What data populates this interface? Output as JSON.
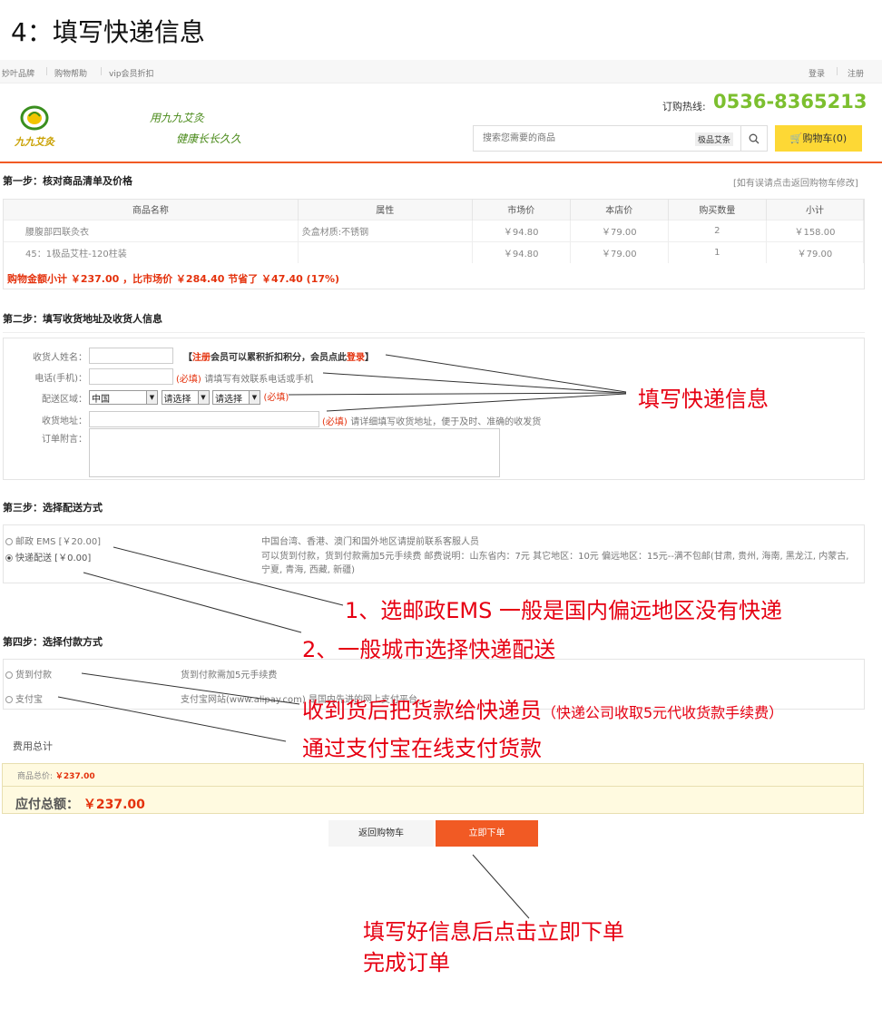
{
  "page_heading": "4：填写快递信息",
  "topbar": {
    "left_links": [
      "妙叶品牌",
      "购物帮助",
      "vip会员折扣"
    ],
    "right_links": [
      "登录",
      "注册"
    ]
  },
  "header": {
    "logo_text": "九九艾灸",
    "slogan_line1": "用九九艾灸",
    "slogan_line2": "健康长长久久",
    "hotline_label": "订购热线:",
    "hotline_number": "0536-8365213",
    "search_placeholder": "搜索您需要的商品",
    "search_tag": "极品艾条",
    "cart_label": "购物车(0)"
  },
  "step1": {
    "title": "第一步：核对商品清单及价格",
    "note": "[如有误请点击返回购物车修改]",
    "columns": [
      "商品名称",
      "属性",
      "市场价",
      "本店价",
      "购买数量",
      "小计"
    ],
    "rows": [
      [
        "腰腹部四联灸衣",
        "灸盒材质:不锈钢",
        "￥94.80",
        "￥79.00",
        "2",
        "￥158.00"
      ],
      [
        "45：1极品艾柱-120柱装",
        "",
        "￥94.80",
        "￥79.00",
        "1",
        "￥79.00"
      ]
    ],
    "summary": "购物金额小计 ￥237.00 ，比市场价 ￥284.40 节省了 ￥47.40 (17%)"
  },
  "step2": {
    "title": "第二步：填写收货地址及收货人信息",
    "name_label": "收货人姓名：",
    "name_hint_pre": "【",
    "name_hint_register": "注册",
    "name_hint_mid": "会员可以累积折扣积分，会员点此",
    "name_hint_login": "登录",
    "name_hint_post": "】",
    "phone_label": "电话(手机)：",
    "required": "(必填)",
    "phone_hint": "请填写有效联系电话或手机",
    "region_label": "配送区域：",
    "country": "中国",
    "select_placeholder": "请选择",
    "address_label": "收货地址：",
    "address_hint": "请详细填写收货地址，便于及时、准确的收发货",
    "remark_label": "订单附言："
  },
  "step3": {
    "title": "第三步：选择配送方式",
    "options": [
      {
        "label": "邮政 EMS [￥20.00]",
        "desc": "中国台湾、香港、澳门和国外地区请提前联系客服人员",
        "selected": false
      },
      {
        "label": "快递配送 [￥0.00]",
        "desc": "可以货到付款，货到付款需加5元手续费 邮费说明：山东省内：7元 其它地区：10元 偏远地区：15元--满不包邮(甘肃, 贵州, 海南, 黑龙江, 内蒙古, 宁夏, 青海, 西藏, 新疆)",
        "selected": true
      }
    ]
  },
  "step4": {
    "title": "第四步：选择付款方式",
    "options": [
      {
        "label": "货到付款",
        "desc": "货到付款需加5元手续费",
        "selected": false
      },
      {
        "label": "支付宝",
        "desc": "支付宝网站(www.alipay.com) 是国内先进的网上支付平台。",
        "selected": false
      }
    ]
  },
  "totals": {
    "section_title": "费用总计",
    "goods_total_label": "商品总价:",
    "goods_total_value": "￥237.00",
    "payable_label": "应付总额：",
    "payable_value": "￥237.00"
  },
  "buttons": {
    "back": "返回购物车",
    "submit": "立即下单"
  },
  "annotations": {
    "fill_express": "填写快递信息",
    "ems_note": "1、选邮政EMS 一般是国内偏远地区没有快递",
    "express_note": "2、一般城市选择快递配送",
    "cod_note": "收到货后把货款给快递员",
    "cod_note_small": "（快递公司收取5元代收货款手续费）",
    "alipay_note": "通过支付宝在线支付货款",
    "final_note_line1": "填写好信息后点击立即下单",
    "final_note_line2": "完成订单"
  },
  "colors": {
    "accent": "#f15a24",
    "annotation": "#e60012",
    "hotline": "#7cbf2f",
    "cart": "#fdd835"
  }
}
